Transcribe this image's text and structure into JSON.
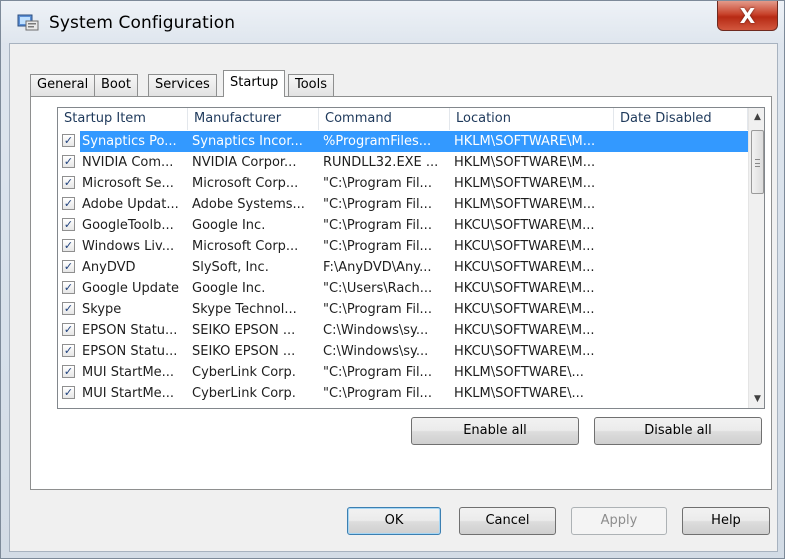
{
  "window": {
    "title": "System Configuration",
    "close_glyph": "X",
    "close_icon": "close-icon",
    "app_icon": "msconfig-icon"
  },
  "tabs": [
    {
      "label": "General",
      "active": false
    },
    {
      "label": "Boot",
      "active": false
    },
    {
      "label": "Services",
      "active": false
    },
    {
      "label": "Startup",
      "active": true
    },
    {
      "label": "Tools",
      "active": false
    }
  ],
  "startup": {
    "columns": [
      "Startup Item",
      "Manufacturer",
      "Command",
      "Location",
      "Date Disabled"
    ],
    "rows": [
      {
        "checked": true,
        "selected": true,
        "item": "Synaptics Po...",
        "manufacturer": "Synaptics Incor...",
        "command": "%ProgramFiles...",
        "location": "HKLM\\SOFTWARE\\M...",
        "date": ""
      },
      {
        "checked": true,
        "selected": false,
        "item": "NVIDIA Com...",
        "manufacturer": "NVIDIA Corpor...",
        "command": "RUNDLL32.EXE ...",
        "location": "HKLM\\SOFTWARE\\M...",
        "date": ""
      },
      {
        "checked": true,
        "selected": false,
        "item": "Microsoft Se...",
        "manufacturer": "Microsoft Corp...",
        "command": "\"C:\\Program Fil...",
        "location": "HKLM\\SOFTWARE\\M...",
        "date": ""
      },
      {
        "checked": true,
        "selected": false,
        "item": "Adobe Updat...",
        "manufacturer": "Adobe Systems...",
        "command": "\"C:\\Program Fil...",
        "location": "HKLM\\SOFTWARE\\M...",
        "date": ""
      },
      {
        "checked": true,
        "selected": false,
        "item": "GoogleToolb...",
        "manufacturer": "Google Inc.",
        "command": "\"C:\\Program Fil...",
        "location": "HKCU\\SOFTWARE\\M...",
        "date": ""
      },
      {
        "checked": true,
        "selected": false,
        "item": "Windows Liv...",
        "manufacturer": "Microsoft Corp...",
        "command": "\"C:\\Program Fil...",
        "location": "HKCU\\SOFTWARE\\M...",
        "date": ""
      },
      {
        "checked": true,
        "selected": false,
        "item": "AnyDVD",
        "manufacturer": "SlySoft, Inc.",
        "command": "F:\\AnyDVD\\Any...",
        "location": "HKCU\\SOFTWARE\\M...",
        "date": ""
      },
      {
        "checked": true,
        "selected": false,
        "item": "Google Update",
        "manufacturer": "Google Inc.",
        "command": "\"C:\\Users\\Rach...",
        "location": "HKCU\\SOFTWARE\\M...",
        "date": ""
      },
      {
        "checked": true,
        "selected": false,
        "item": "Skype",
        "manufacturer": "Skype Technol...",
        "command": "\"C:\\Program Fil...",
        "location": "HKCU\\SOFTWARE\\M...",
        "date": ""
      },
      {
        "checked": true,
        "selected": false,
        "item": "EPSON Statu...",
        "manufacturer": "SEIKO EPSON ...",
        "command": "C:\\Windows\\sy...",
        "location": "HKCU\\SOFTWARE\\M...",
        "date": ""
      },
      {
        "checked": true,
        "selected": false,
        "item": "EPSON Statu...",
        "manufacturer": "SEIKO EPSON ...",
        "command": "C:\\Windows\\sy...",
        "location": "HKCU\\SOFTWARE\\M...",
        "date": ""
      },
      {
        "checked": true,
        "selected": false,
        "item": "MUI StartMe...",
        "manufacturer": "CyberLink Corp.",
        "command": "\"C:\\Program Fil...",
        "location": "HKLM\\SOFTWARE\\...",
        "date": ""
      },
      {
        "checked": true,
        "selected": false,
        "item": "MUI StartMe...",
        "manufacturer": "CyberLink Corp.",
        "command": "\"C:\\Program Fil...",
        "location": "HKLM\\SOFTWARE\\...",
        "date": ""
      }
    ],
    "check_glyph": "✓",
    "scroll_up_glyph": "▲",
    "scroll_down_glyph": "▼"
  },
  "buttons": {
    "enable_all": "Enable all",
    "disable_all": "Disable all",
    "ok": "OK",
    "cancel": "Cancel",
    "apply": "Apply",
    "help": "Help"
  },
  "colors": {
    "selection": "#3399ff",
    "close_button": "#c8432c"
  }
}
